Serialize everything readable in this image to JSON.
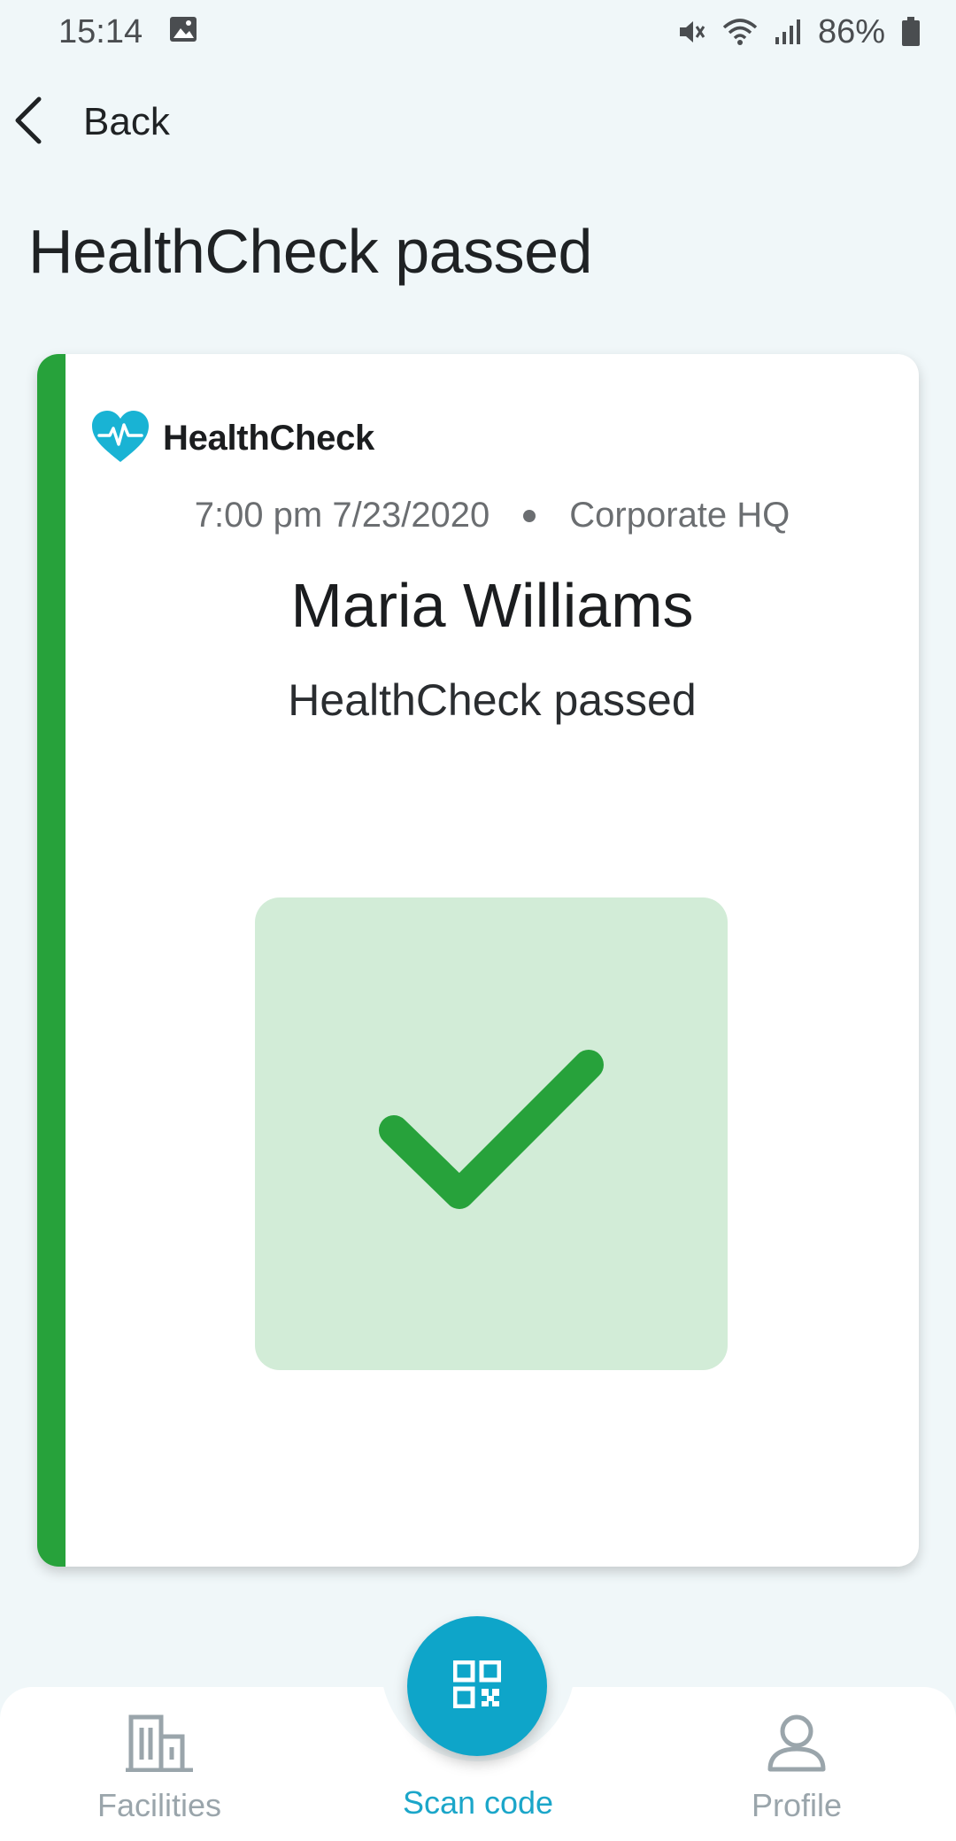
{
  "status_bar": {
    "time": "15:14",
    "battery": "86%",
    "icons": [
      "image-icon",
      "mute-icon",
      "wifi-icon",
      "signal-icon",
      "battery-icon"
    ]
  },
  "nav": {
    "back_label": "Back"
  },
  "page": {
    "title": "HealthCheck passed"
  },
  "card": {
    "brand_name": "HealthCheck",
    "datetime": "7:00 pm 7/23/2020",
    "location": "Corporate HQ",
    "person_name": "Maria Williams",
    "result": "HealthCheck passed",
    "status_icon": "checkmark-icon",
    "accent_color": "#27a23b",
    "result_bg_color": "#d2ecd7"
  },
  "bottom_nav": {
    "facilities_label": "Facilities",
    "scan_label": "Scan code",
    "profile_label": "Profile",
    "active_color": "#1ba6c9",
    "inactive_color": "#9aa5ab"
  }
}
